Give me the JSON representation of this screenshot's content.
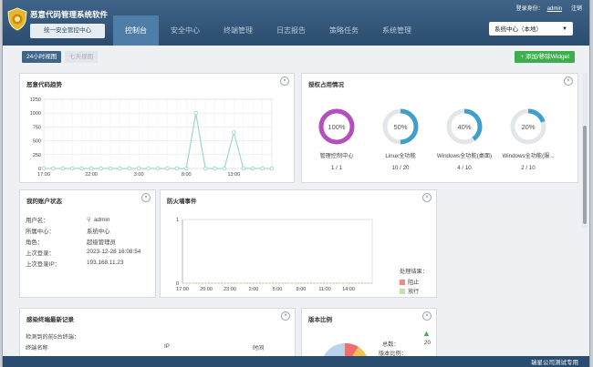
{
  "header": {
    "app_title": "恶意代码管理系统软件",
    "subtitle": "统一安全管控中心",
    "login_label": "登录身份：",
    "username": "admin",
    "logout_label": "注销",
    "center_select": "系统中心（本地）"
  },
  "nav": [
    "控制台",
    "安全中心",
    "终端管理",
    "日志报告",
    "策略任务",
    "系统管理"
  ],
  "toolbar": {
    "btn_24h": "24小时视图",
    "btn_7d": "七天视图",
    "btn_add": "+ 添加/移除Widget"
  },
  "malware_trend": {
    "title": "恶意代码趋势"
  },
  "license_usage": {
    "title": "授权占用情况",
    "items": [
      {
        "percent": "100%",
        "label": "管理控制中心",
        "count": "1 / 1",
        "color": "#b34fbf",
        "value": 1.0
      },
      {
        "percent": "50%",
        "label": "Linux全功能",
        "count": "10 / 20",
        "color": "#3fa0cc",
        "value": 0.5
      },
      {
        "percent": "40%",
        "label": "Windows全功能(桌面)",
        "count": "4 / 10",
        "color": "#3fa0cc",
        "value": 0.4
      },
      {
        "percent": "20%",
        "label": "Windows全功能(服...",
        "count": "2 / 10",
        "color": "#3fa0cc",
        "value": 0.2
      }
    ]
  },
  "account_status": {
    "title": "我的账户状态",
    "rows": [
      {
        "label": "用户名：",
        "value": "admin"
      },
      {
        "label": "所属中心：",
        "value": "系统中心"
      },
      {
        "label": "角色：",
        "value": "超级管理员"
      },
      {
        "label": "上次登录：",
        "value": "2023-12-28 16:08:54"
      },
      {
        "label": "上次登录IP：",
        "value": "193.168.11.23"
      }
    ]
  },
  "firewall_events": {
    "title": "防火墙事件",
    "legend_title": "处理结果：",
    "legend": [
      {
        "name": "阻止",
        "color": "#ef8a8a"
      },
      {
        "name": "放行",
        "color": "#bfe3a8"
      }
    ]
  },
  "recent_infections": {
    "title": "感染终端最新记录",
    "subtitle": "检测到的前5台终端：",
    "columns": [
      "终端名称",
      "IP",
      "时间"
    ]
  },
  "version_ratio": {
    "title": "版本比例",
    "total_label": "总数：",
    "total_value": "20",
    "version_label": "版本比例："
  },
  "footer": {
    "text": "瑞星公司测试专用"
  },
  "chart_data": [
    {
      "type": "line",
      "title": "",
      "x": [
        "17:00",
        "18:00",
        "19:00",
        "20:00",
        "21:00",
        "22:00",
        "23:00",
        "0:00",
        "1:00",
        "2:00",
        "3:00",
        "4:00",
        "5:00",
        "6:00",
        "7:00",
        "8:00",
        "9:00",
        "10:00",
        "11:00",
        "12:00",
        "13:00",
        "14:00",
        "15:00",
        "16:00",
        "17:00"
      ],
      "series": [
        {
          "values": [
            0,
            0,
            0,
            0,
            0,
            0,
            0,
            0,
            0,
            0,
            0,
            0,
            0,
            0,
            0,
            0,
            1000,
            0,
            0,
            0,
            650,
            0,
            0,
            0,
            0
          ]
        }
      ],
      "xticks": [
        "17:00",
        "22:00",
        "3:00",
        "8:00",
        "13:00"
      ],
      "yticks": [
        "0",
        "250",
        "500",
        "750",
        "1000",
        "1250"
      ],
      "ylim": [
        0,
        1250
      ],
      "color": "#9fd6cf"
    },
    {
      "type": "line",
      "title": "",
      "x": [
        "17:00",
        "18:00",
        "19:00",
        "20:00",
        "21:00",
        "22:00",
        "23:00",
        "0:00",
        "1:00",
        "2:00",
        "3:00",
        "4:00",
        "5:00",
        "6:00",
        "7:00",
        "8:00",
        "9:00",
        "10:00",
        "11:00",
        "12:00",
        "13:00",
        "14:00",
        "15:00",
        "16:00",
        "17:00"
      ],
      "series": [
        {
          "name": "阻止",
          "values": [
            0,
            0,
            0,
            0,
            0,
            0,
            0,
            0,
            0,
            0,
            0,
            0,
            0,
            0,
            0,
            0,
            0,
            0,
            0,
            0,
            0,
            0,
            0,
            0,
            0
          ]
        },
        {
          "name": "放行",
          "values": [
            0,
            0,
            0,
            0,
            0,
            0,
            0,
            0,
            0,
            0,
            0,
            0,
            0,
            0,
            0,
            0,
            0,
            0,
            0,
            0,
            0,
            0,
            0,
            0,
            0
          ]
        }
      ],
      "xticks": [
        "17:00",
        "20:00",
        "23:00",
        "2:00",
        "5:00",
        "8:00",
        "11:00",
        "14:00"
      ],
      "yticks": [
        "0",
        "1"
      ],
      "ylim": [
        0,
        1
      ]
    }
  ]
}
